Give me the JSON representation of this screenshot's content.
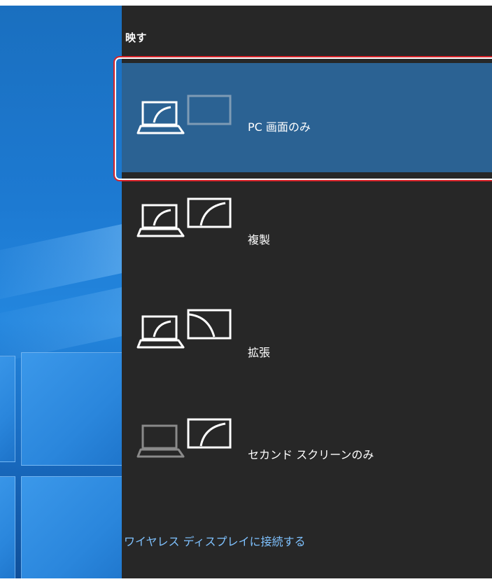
{
  "panel": {
    "title": "映す",
    "options": [
      {
        "label": "PC 画面のみ",
        "icon": "pc-screen-only-icon",
        "selected": true
      },
      {
        "label": "複製",
        "icon": "duplicate-icon",
        "selected": false
      },
      {
        "label": "拡張",
        "icon": "extend-icon",
        "selected": false
      },
      {
        "label": "セカンド スクリーンのみ",
        "icon": "second-screen-only-icon",
        "selected": false
      }
    ],
    "wireless_link": "ワイヤレス ディスプレイに接続する"
  },
  "colors": {
    "panel_bg": "#272727",
    "selected_bg": "#2b6293",
    "link": "#7fc2ff",
    "highlight": "#d8232a"
  }
}
